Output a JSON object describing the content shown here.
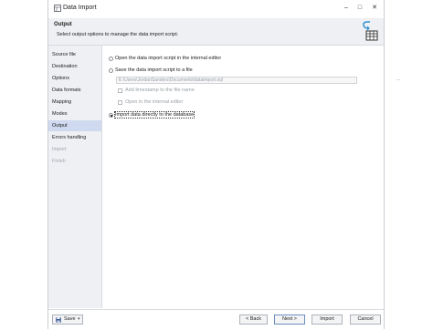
{
  "window": {
    "title": "Data Import"
  },
  "header": {
    "title": "Output",
    "subtitle": "Select output options to manage the data import script."
  },
  "sidebar": {
    "items": [
      {
        "label": "Source file",
        "state": "normal"
      },
      {
        "label": "Destination",
        "state": "normal"
      },
      {
        "label": "Options",
        "state": "normal"
      },
      {
        "label": "Data formats",
        "state": "normal"
      },
      {
        "label": "Mapping",
        "state": "normal"
      },
      {
        "label": "Modes",
        "state": "normal"
      },
      {
        "label": "Output",
        "state": "active"
      },
      {
        "label": "Errors handling",
        "state": "normal"
      },
      {
        "label": "Import",
        "state": "disabled"
      },
      {
        "label": "Finish",
        "state": "disabled"
      }
    ]
  },
  "output": {
    "open_editor_label": "Open the data import script in the internal editor",
    "save_file_label": "Save the data import script to a file",
    "file_path": "E:\\Users\\JordanSanders\\Documents\\dataimport.sql",
    "browse_label": "...",
    "add_timestamp_label": "Add timestamp to the file name",
    "open_internal_label": "Open in the internal editor",
    "import_direct_label": "Import data directly to the database",
    "selected": "import_direct"
  },
  "footer": {
    "save_label": "Save",
    "back_label": "< Back",
    "next_label": "Next >",
    "import_label": "Import",
    "cancel_label": "Cancel"
  }
}
